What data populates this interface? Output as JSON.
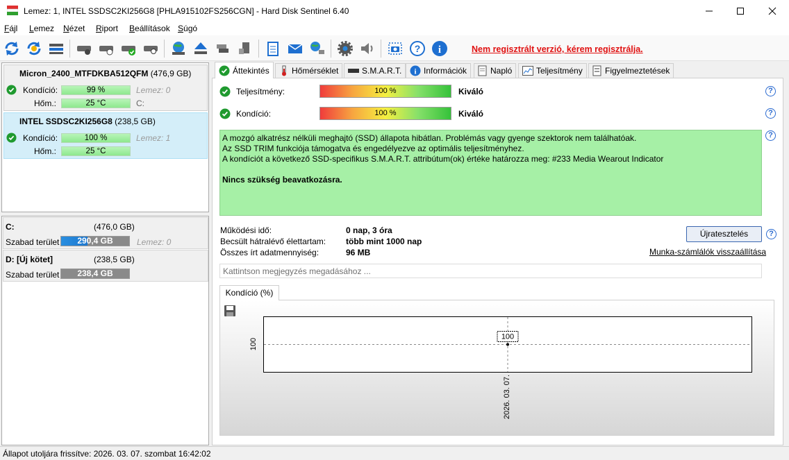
{
  "window": {
    "title": "Lemez: 1, INTEL SSDSC2KI256G8 [PHLA915102FS256CGN]  -  Hard Disk Sentinel 6.40"
  },
  "menu": [
    "Fájl",
    "Lemez",
    "Nézet",
    "Riport",
    "Beállítások",
    "Súgó"
  ],
  "unregistered": "Nem regisztrált verzió, kérem regisztrálja.",
  "disks": [
    {
      "name": "Micron_2400_MTFDKBA512QFM",
      "size": "(476,9 GB)",
      "kondicio_label": "Kondíció:",
      "kondicio": "99 %",
      "hom_label": "Hőm.:",
      "hom": "25 °C",
      "lemez": "Lemez: 0",
      "drive": "C:"
    },
    {
      "name": "INTEL SSDSC2KI256G8",
      "size": "(238,5 GB)",
      "kondicio_label": "Kondíció:",
      "kondicio": "100 %",
      "hom_label": "Hőm.:",
      "hom": "25 °C",
      "lemez": "Lemez: 1"
    }
  ],
  "volumes": [
    {
      "name": "C:",
      "size": "(476,0 GB)",
      "free_label": "Szabad terület",
      "free": "290,4 GB",
      "lemez": "Lemez: 0",
      "used_fraction": 0.39
    },
    {
      "name": "D: [Új kötet]",
      "size": "(238,5 GB)",
      "free_label": "Szabad terület",
      "free": "238,4 GB",
      "used_fraction": 0.0
    }
  ],
  "tabs": [
    "Áttekintés",
    "Hőmérséklet",
    "S.M.A.R.T.",
    "Információk",
    "Napló",
    "Teljesítmény",
    "Figyelmeztetések"
  ],
  "overview": {
    "perf_label": "Teljesítmény:",
    "perf_value": "100 %",
    "perf_rating": "Kiváló",
    "cond_label": "Kondíció:",
    "cond_value": "100 %",
    "cond_rating": "Kiváló",
    "status_lines": [
      "A mozgó alkatrész nélküli meghajtó (SSD) állapota hibátlan. Problémás vagy gyenge szektorok nem találhatóak.",
      "Az SSD TRIM funkciója támogatva és engedélyezve az optimális teljesítményhez.",
      "A kondíciót a következő SSD-specifikus S.M.A.R.T. attribútum(ok) értéke határozza meg:  #233 Media Wearout Indicator"
    ],
    "status_strong": "Nincs szükség beavatkozásra.",
    "uptime_label": "Működési idő:",
    "uptime": "0 nap, 3 óra",
    "remaining_label": "Becsült hátralévő élettartam:",
    "remaining": "több mint 1000 nap",
    "written_label": "Összes írt adatmennyiség:",
    "written": "96 MB",
    "retest_button": "Újratesztelés",
    "reset_counters": "Munka-számlálók visszaállítása",
    "note_placeholder": "Kattintson megjegyzés megadásához ..."
  },
  "chart_tab": "Kondíció  (%)",
  "chart_data": {
    "type": "line",
    "x": [
      "2026. 03. 07."
    ],
    "series": [
      {
        "values": [
          100
        ]
      }
    ],
    "y_tick_labels": [
      "100"
    ],
    "data_labels": [
      "100"
    ]
  },
  "statusbar": "Állapot utoljára frissítve: 2026. 03. 07. szombat 16:42:02"
}
